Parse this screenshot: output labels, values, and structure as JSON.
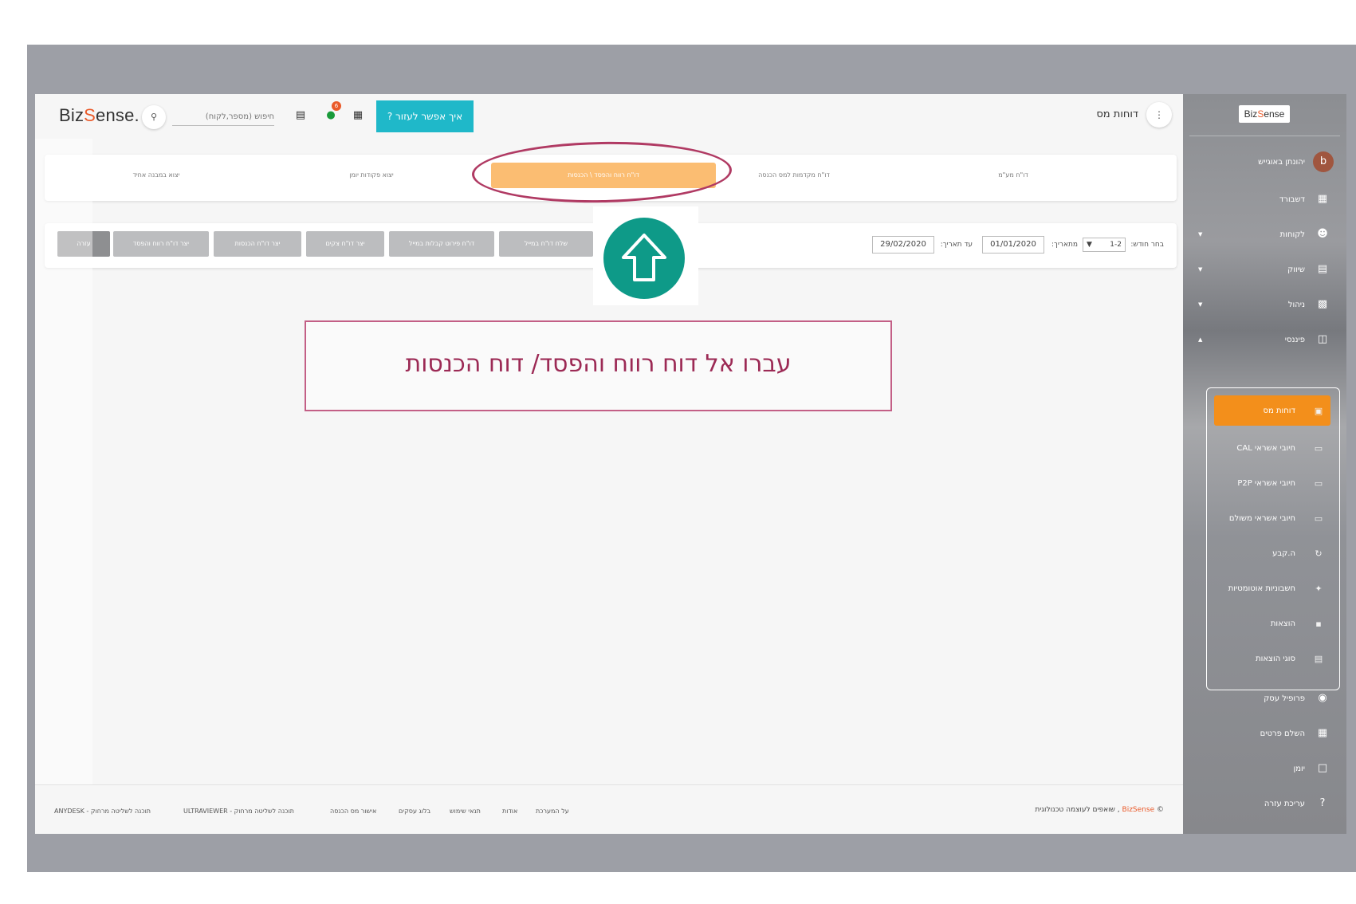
{
  "header": {
    "logo_prefix": "Biz",
    "logo_s": "S",
    "logo_suffix": "ense.",
    "search_placeholder": "חיפוש (מספר,לקוח)",
    "notification_count": "6",
    "help_button": "איך אפשר לעזור ?",
    "page_title": "דוחות מס"
  },
  "tabs": [
    {
      "label": "דו\"ח מע\"מ"
    },
    {
      "label": "דו\"ח מקדמות למס הכנסה"
    },
    {
      "label": "דו\"ח רווח והפסד \\ הכנסות"
    },
    {
      "label": "יצוא פקודות יומן"
    },
    {
      "label": "יצוא במבנה אחיד"
    }
  ],
  "filters": {
    "month_label": "בחר חודש:",
    "month_value": "1-2",
    "from_label": "מתאריך:",
    "from_value": "01/01/2020",
    "to_label": "עד תאריך:",
    "to_value": "29/02/2020",
    "buttons": [
      "שלח דו\"ח במייל",
      "דו\"ח פירוט קבלות במייל",
      "יצר דו\"ח צקים",
      "יצר דו\"ח הכנסות",
      "יצר דו\"ח רווח והפסד",
      "עזרה"
    ]
  },
  "callout_text": "עברו אל דוח רווח והפסד/ דוח הכנסות",
  "sidebar": {
    "brand_prefix": "Biz",
    "brand_s": "S",
    "brand_suffix": "ense",
    "user_initial": "b",
    "user_name": "יהונתן באוגייש",
    "items": [
      {
        "label": "דשבורד",
        "icon": "dashboard-icon"
      },
      {
        "label": "לקוחות",
        "icon": "people-icon"
      },
      {
        "label": "שיווק",
        "icon": "store-icon"
      },
      {
        "label": "ניהול",
        "icon": "chart-icon"
      },
      {
        "label": "פיננסי",
        "icon": "document-icon"
      }
    ],
    "submenu": [
      {
        "label": "דוחות מס",
        "icon": "report-icon"
      },
      {
        "label": "חיובי אשראי CAL",
        "icon": "credit-card-icon"
      },
      {
        "label": "חיובי אשראי P2P",
        "icon": "credit-card-icon"
      },
      {
        "label": "חיובי אשראי משולם",
        "icon": "credit-card-icon"
      },
      {
        "label": "ה.קבע",
        "icon": "refresh-icon"
      },
      {
        "label": "חשבוניות אוטומטיות",
        "icon": "magic-icon"
      },
      {
        "label": "הוצאות",
        "icon": "money-icon"
      },
      {
        "label": "סוגי הוצאות",
        "icon": "list-icon"
      }
    ],
    "bottom_items": [
      {
        "label": "פרופיל עסק",
        "icon": "location-icon"
      },
      {
        "label": "השלם פרטים",
        "icon": "widgets-icon"
      },
      {
        "label": "יומן",
        "icon": "calendar-icon"
      },
      {
        "label": "עריכת עזרה",
        "icon": "help-icon"
      }
    ]
  },
  "footer": {
    "links": [
      "על המערכת",
      "אודות",
      "תנאי שימוש",
      "בלוג עסקים",
      "אישור מס הכנסה",
      "תוכנה לשליטה מרחוק - ULTRAVIEWER",
      "תוכנה לשליטה מרחוק - ANYDESK"
    ],
    "copyright_symbol": "©",
    "copyright_brand": "BizSense",
    "copyright_text": ", שואפים לעוצמה טכנולוגית"
  },
  "colors": {
    "accent_orange": "#f38f1b",
    "tab_active": "#fbbd72",
    "help_teal": "#1fb8c9",
    "arrow_green": "#0e9a88",
    "callout_text": "#9c2a55",
    "highlight_ring": "#b03a63"
  }
}
